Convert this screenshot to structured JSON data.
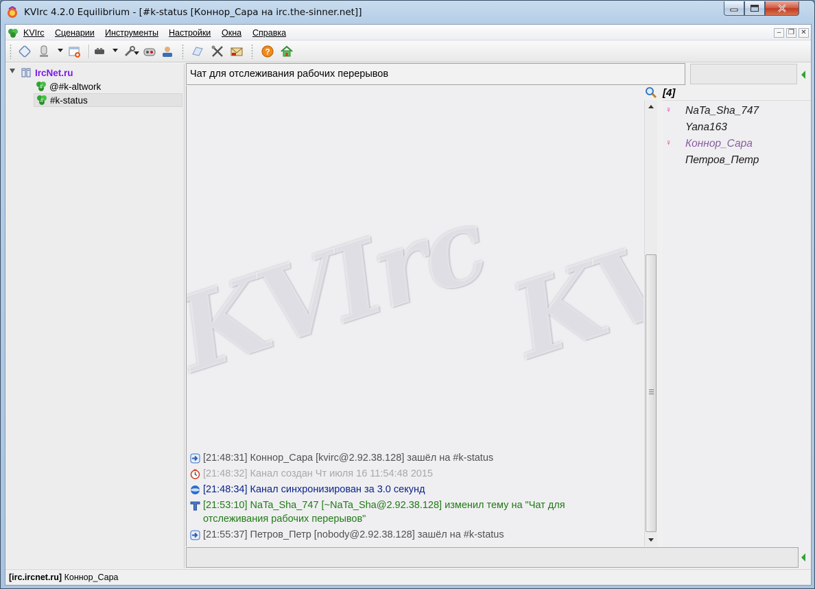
{
  "window": {
    "title": "KVIrc 4.2.0 Equilibrium - [#k-status [Коннор_Сара на irc.the-sinner.net]]"
  },
  "menubar": {
    "items": [
      {
        "label": "KVIrc"
      },
      {
        "label": "Сценарии"
      },
      {
        "label": "Инструменты"
      },
      {
        "label": "Настройки"
      },
      {
        "label": "Окна"
      },
      {
        "label": "Справка"
      }
    ]
  },
  "tree": {
    "server": "IrcNet.ru",
    "channels": [
      "@#k-altwork",
      "#k-status"
    ],
    "selected": "#k-status"
  },
  "topic": {
    "text": "Чат для отслеживания рабочих перерывов"
  },
  "chat": {
    "watermark": "KVIrc",
    "lines": [
      {
        "icon": "join-arrow-icon",
        "time": "[21:48:31]",
        "text": "Коннор_Сара [kvirc@2.92.38.128] зашёл на #k-status",
        "kind": "join"
      },
      {
        "icon": "clock-icon",
        "time": "[21:48:32]",
        "text": "Канал создан Чт июля 16 11:54:48 2015",
        "kind": "created"
      },
      {
        "icon": "sync-sphere-icon",
        "time": "[21:48:34]",
        "text": "Канал синхронизирован за 3.0 секунд",
        "kind": "sync"
      },
      {
        "icon": "topic-t-icon",
        "time": "[21:53:10]",
        "text": "NaTa_Sha_747 [~NaTa_Sha@2.92.38.128] изменил тему на \"Чат для",
        "text2": "отслеживания рабочих перерывов\"",
        "kind": "topic"
      },
      {
        "icon": "join-arrow-icon",
        "time": "[21:55:37]",
        "text": "Петров_Петр [nobody@2.92.38.128] зашёл на #k-status",
        "kind": "join"
      }
    ]
  },
  "userlist": {
    "count": "[4]",
    "users": [
      {
        "nick": "NaTa_Sha_747",
        "female": true,
        "color": "#1a1a1a"
      },
      {
        "nick": "Yana163",
        "female": false,
        "color": "#1a1a1a"
      },
      {
        "nick": "Коннор_Сара",
        "female": true,
        "color": "#8a5aa0"
      },
      {
        "nick": "Петров_Петр",
        "female": false,
        "color": "#1a1a1a"
      }
    ]
  },
  "statusbar": {
    "server": "[irc.ircnet.ru]",
    "nick": "Коннор_Сара"
  },
  "colors": {
    "server_link": "#7d17e8",
    "join": "#505050",
    "created": "#a8a8a8",
    "sync": "#0a238b",
    "topic_change": "#1f7a14",
    "female_marker": "#e0208c",
    "own_nick": "#8a5aa0"
  }
}
